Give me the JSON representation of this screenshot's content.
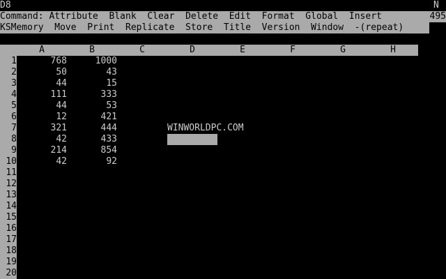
{
  "status": {
    "cell_ref": "D8",
    "mode": "N",
    "memory": "495"
  },
  "menu": {
    "line1": "Command: Attribute  Blank  Clear  Delete  Edit  Format  Global  Insert",
    "line2": "KSMemory  Move  Print  Replicate  Store  Title  Version  Window  -(repeat)"
  },
  "sheet": {
    "columns": [
      "A",
      "B",
      "C",
      "D",
      "E",
      "F",
      "G",
      "H"
    ],
    "rows": [
      "1",
      "2",
      "3",
      "4",
      "5",
      "6",
      "7",
      "8",
      "9",
      "10",
      "11",
      "12",
      "13",
      "14",
      "15",
      "16",
      "17",
      "18",
      "19",
      "20"
    ],
    "col_a": [
      "768",
      "50",
      "44",
      "111",
      "44",
      "12",
      "321",
      "42",
      "214",
      "42"
    ],
    "col_b": [
      "1000",
      "43",
      "15",
      "333",
      "53",
      "421",
      "444",
      "433",
      "854",
      "92"
    ],
    "d7_text": "WINWORLDPC.COM"
  }
}
